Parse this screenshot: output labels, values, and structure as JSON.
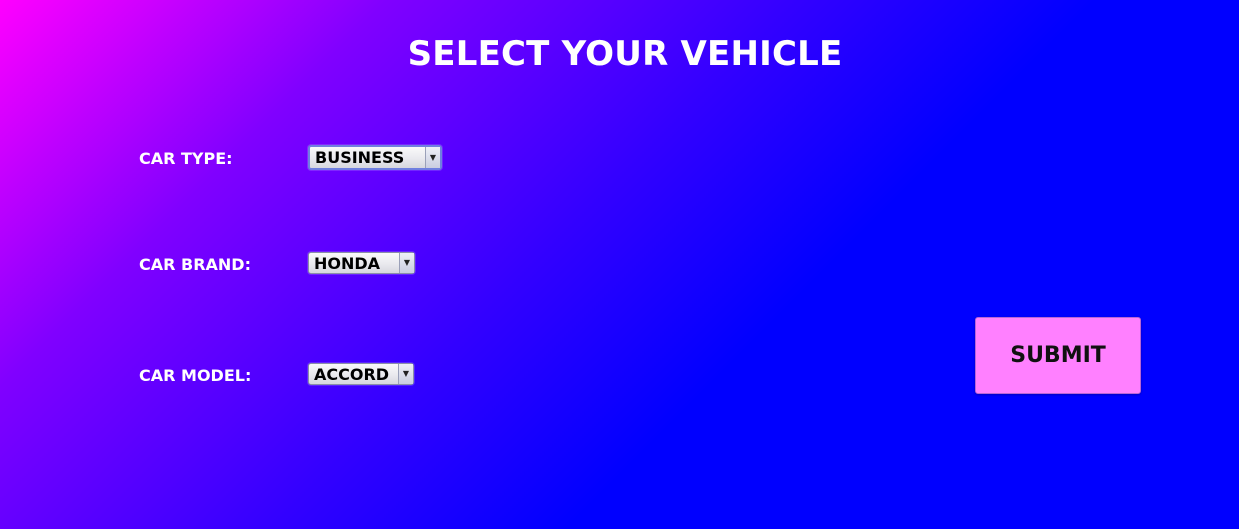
{
  "page": {
    "title": "SELECT YOUR VEHICLE"
  },
  "form": {
    "car_type": {
      "label": "CAR TYPE:",
      "value": "BUSINESS"
    },
    "car_brand": {
      "label": "CAR BRAND:",
      "value": "HONDA"
    },
    "car_model": {
      "label": "CAR MODEL:",
      "value": "ACCORD"
    },
    "submit_label": "SUBMIT"
  },
  "colors": {
    "gradient_start": "#ff00ff",
    "gradient_end": "#0000ff",
    "submit_background": "#ff80ff",
    "text": "#ffffff"
  },
  "icons": {
    "dropdown": "chevron-down-icon"
  }
}
